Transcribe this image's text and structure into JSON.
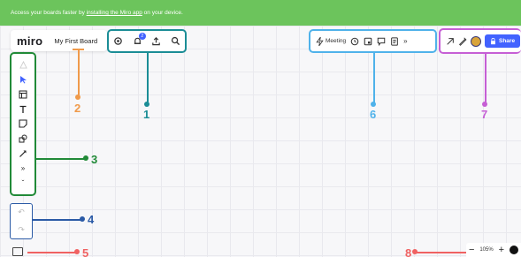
{
  "banner": {
    "text_before": "Access your boards faster by ",
    "link": "installing the Miro app",
    "text_after": " on your device.",
    "color": "#6cc45c"
  },
  "logo": "miro",
  "board_name": "My First Board",
  "notification_count": "2",
  "collaboration": {
    "meeting_label": "Meeting",
    "share_label": "Share"
  },
  "zoom": {
    "level": "105%"
  },
  "markers": {
    "m1": "1",
    "m2": "2",
    "m3": "3",
    "m4": "4",
    "m5": "5",
    "m6": "6",
    "m7": "7",
    "m8": "8"
  },
  "colors": {
    "m1": "#1b8d96",
    "m2": "#f09a4a",
    "m3": "#218a38",
    "m4": "#2b5aa6",
    "m5": "#f06262",
    "m6": "#4fb2ea",
    "m7": "#c65fd5",
    "m8": "#f06262",
    "share": "#4262ff"
  },
  "icons": {
    "group1": [
      "settings-icon",
      "notifications-icon",
      "export-icon",
      "search-icon"
    ],
    "group6": [
      "meeting-icon",
      "timer-icon",
      "screen-share-icon",
      "comments-icon",
      "notes-icon",
      "more-icon"
    ],
    "group7": [
      "reactions-icon",
      "draw-icon",
      "avatar",
      "share-button"
    ],
    "toolbar": [
      "templates-icon",
      "select-icon",
      "frame-icon",
      "text-icon",
      "sticky-note-icon",
      "shapes-icon",
      "connection-line-icon",
      "more-tools-icon",
      "collapse-icon"
    ],
    "undo": [
      "undo-icon",
      "redo-icon"
    ]
  }
}
